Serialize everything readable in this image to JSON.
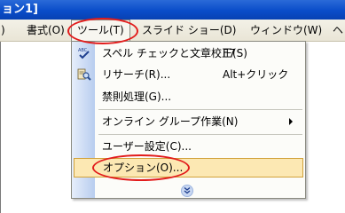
{
  "window": {
    "title": "ョン1]"
  },
  "menubar": {
    "items": [
      {
        "label": ")"
      },
      {
        "label": "書式(O)"
      },
      {
        "label": "ツール(T)"
      },
      {
        "label": "スライド ショー(D)"
      },
      {
        "label": "ウィンドウ(W)"
      },
      {
        "label": "ヘ"
      }
    ]
  },
  "tools_menu": {
    "items": [
      {
        "label": "スペル チェックと文章校正(S)",
        "shortcut": "F7",
        "icon": "spell-check-icon"
      },
      {
        "label": "リサーチ(R)...",
        "shortcut": "Alt+クリック",
        "icon": "research-icon"
      },
      {
        "label": "禁則処理(G)..."
      },
      {
        "label": "オンライン グループ作業(N)",
        "submenu": true
      },
      {
        "label": "ユーザー設定(C)..."
      },
      {
        "label": "オプション(O)...",
        "highlighted": true
      }
    ],
    "expand_icon": "chevron-double-down-icon"
  },
  "annotations": {
    "oval_color": "#e21c1c"
  },
  "colors": {
    "highlight": "#fce8b3",
    "title_bar": "#0a4dc9"
  }
}
